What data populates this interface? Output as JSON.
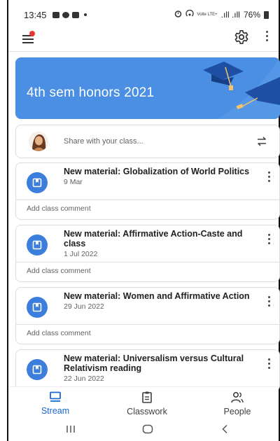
{
  "status_bar": {
    "time": "13:45",
    "network_text": "Volte LTE+",
    "signal_text": ".ıll .ıll",
    "battery": "76%"
  },
  "icons": {
    "menu": "menu-icon",
    "notification": "notification-dot",
    "settings": "gear-icon",
    "more": "more-vert-icon",
    "repost": "repost-icon",
    "material": "bookmark-icon",
    "stream": "stream-icon",
    "classwork": "classwork-icon",
    "people": "people-icon"
  },
  "colors": {
    "banner": "#4a8fe3",
    "accent": "#1967d2",
    "material_icon": "#3c7edc",
    "notification": "#e53935"
  },
  "banner": {
    "title": "4th sem honors 2021"
  },
  "share": {
    "placeholder": "Share with your class..."
  },
  "posts": [
    {
      "title": "New material: Globalization of World Politics",
      "date": "9 Mar",
      "comment": "Add class comment"
    },
    {
      "title": "New material: Affirmative Action-Caste and class",
      "date": "1 Jul 2022",
      "comment": "Add class comment"
    },
    {
      "title": "New material: Women and Affirmative Action",
      "date": "29 Jun 2022",
      "comment": "Add class comment"
    },
    {
      "title": "New material: Universalism versus Cultural Relativism reading",
      "date": "22 Jun 2022",
      "comment": ""
    }
  ],
  "bottom_nav": {
    "stream": "Stream",
    "classwork": "Classwork",
    "people": "People",
    "active": "Stream"
  }
}
